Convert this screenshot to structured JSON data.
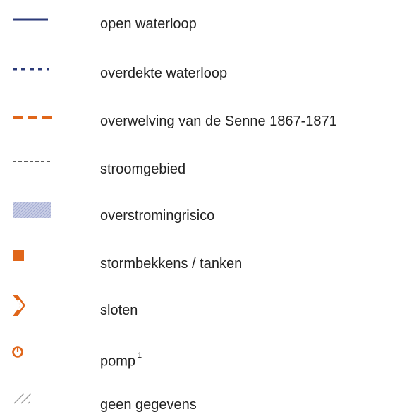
{
  "legend": {
    "items": [
      {
        "id": "open",
        "label": "open waterloop",
        "icon": "solid-line-icon"
      },
      {
        "id": "covered",
        "label": "overdekte waterloop",
        "icon": "dotted-line-icon"
      },
      {
        "id": "vaulting",
        "label": "overwelving van de Senne 1867-1871",
        "icon": "dashed-line-icon"
      },
      {
        "id": "basin",
        "label": "stroomgebied",
        "icon": "thin-dashed-line-icon"
      },
      {
        "id": "flood",
        "label": "overstromingrisico",
        "icon": "hatched-area-icon"
      },
      {
        "id": "storm",
        "label": "stormbekkens / tanken",
        "icon": "square-icon"
      },
      {
        "id": "lock",
        "label": "sloten",
        "icon": "chevron-icon"
      },
      {
        "id": "pump",
        "label": "pomp",
        "footnote": "1",
        "icon": "pump-icon"
      },
      {
        "id": "nodata",
        "label": "geen gegevens",
        "icon": "diagonal-lines-icon"
      }
    ]
  },
  "colors": {
    "navy": "#2b3a78",
    "orange": "#e0661a",
    "black": "#222222",
    "hatch_fill": "#c9cee6",
    "hatch_line": "#8c96c4",
    "grey": "#9a9a9a"
  }
}
